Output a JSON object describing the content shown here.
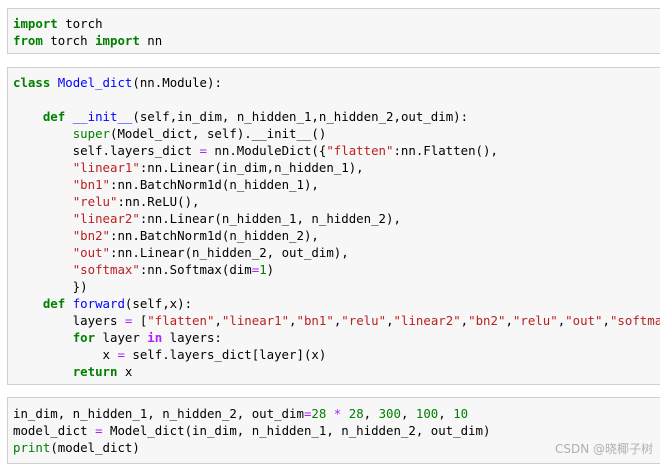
{
  "cells": [
    {
      "name": "import-cell",
      "lines": [
        [
          [
            "kw",
            "import"
          ],
          [
            "t",
            " torch"
          ]
        ],
        [
          [
            "kw",
            "from"
          ],
          [
            "t",
            " torch "
          ],
          [
            "kw",
            "import"
          ],
          [
            "t",
            " nn"
          ]
        ]
      ]
    },
    {
      "name": "class-cell",
      "lines": [
        [
          [
            "kw",
            "class"
          ],
          [
            "t",
            " "
          ],
          [
            "fn",
            "Model_dict"
          ],
          [
            "t",
            "(nn.Module):"
          ]
        ],
        [],
        [
          [
            "t",
            "    "
          ],
          [
            "kw",
            "def"
          ],
          [
            "t",
            " "
          ],
          [
            "fn",
            "__init__"
          ],
          [
            "t",
            "(self,in_dim, n_hidden_1,n_hidden_2,out_dim):"
          ]
        ],
        [
          [
            "t",
            "        "
          ],
          [
            "bi",
            "super"
          ],
          [
            "t",
            "(Model_dict, self).__init__()"
          ]
        ],
        [
          [
            "t",
            "        self.layers_dict "
          ],
          [
            "opn",
            "="
          ],
          [
            "t",
            " nn.ModuleDict({"
          ],
          [
            "str",
            "\"flatten\""
          ],
          [
            "t",
            ":nn.Flatten(),"
          ]
        ],
        [
          [
            "t",
            "        "
          ],
          [
            "str",
            "\"linear1\""
          ],
          [
            "t",
            ":nn.Linear(in_dim,n_hidden_1),"
          ]
        ],
        [
          [
            "t",
            "        "
          ],
          [
            "str",
            "\"bn1\""
          ],
          [
            "t",
            ":nn.BatchNorm1d(n_hidden_1),"
          ]
        ],
        [
          [
            "t",
            "        "
          ],
          [
            "str",
            "\"relu\""
          ],
          [
            "t",
            ":nn.ReLU(),"
          ]
        ],
        [
          [
            "t",
            "        "
          ],
          [
            "str",
            "\"linear2\""
          ],
          [
            "t",
            ":nn.Linear(n_hidden_1, n_hidden_2),"
          ]
        ],
        [
          [
            "t",
            "        "
          ],
          [
            "str",
            "\"bn2\""
          ],
          [
            "t",
            ":nn.BatchNorm1d(n_hidden_2),"
          ]
        ],
        [
          [
            "t",
            "        "
          ],
          [
            "str",
            "\"out\""
          ],
          [
            "t",
            ":nn.Linear(n_hidden_2, out_dim),"
          ]
        ],
        [
          [
            "t",
            "        "
          ],
          [
            "str",
            "\"softmax\""
          ],
          [
            "t",
            ":nn.Softmax(dim"
          ],
          [
            "opn",
            "="
          ],
          [
            "num",
            "1"
          ],
          [
            "t",
            ")"
          ]
        ],
        [
          [
            "t",
            "        })"
          ]
        ],
        [
          [
            "t",
            "    "
          ],
          [
            "kw",
            "def"
          ],
          [
            "t",
            " "
          ],
          [
            "fn",
            "forward"
          ],
          [
            "t",
            "(self,x):"
          ]
        ],
        [
          [
            "t",
            "        layers "
          ],
          [
            "opn",
            "="
          ],
          [
            "t",
            " ["
          ],
          [
            "str",
            "\"flatten\""
          ],
          [
            "t",
            ","
          ],
          [
            "str",
            "\"linear1\""
          ],
          [
            "t",
            ","
          ],
          [
            "str",
            "\"bn1\""
          ],
          [
            "t",
            ","
          ],
          [
            "str",
            "\"relu\""
          ],
          [
            "t",
            ","
          ],
          [
            "str",
            "\"linear2\""
          ],
          [
            "t",
            ","
          ],
          [
            "str",
            "\"bn2\""
          ],
          [
            "t",
            ","
          ],
          [
            "str",
            "\"relu\""
          ],
          [
            "t",
            ","
          ],
          [
            "str",
            "\"out\""
          ],
          [
            "t",
            ","
          ],
          [
            "str",
            "\"softmax\""
          ],
          [
            "t",
            "]"
          ]
        ],
        [
          [
            "t",
            "        "
          ],
          [
            "kw",
            "for"
          ],
          [
            "t",
            " layer "
          ],
          [
            "op",
            "in"
          ],
          [
            "t",
            " layers:"
          ]
        ],
        [
          [
            "t",
            "            x "
          ],
          [
            "opn",
            "="
          ],
          [
            "t",
            " self.layers_dict[layer](x)"
          ]
        ],
        [
          [
            "t",
            "        "
          ],
          [
            "kw",
            "return"
          ],
          [
            "t",
            " x"
          ]
        ]
      ]
    },
    {
      "name": "usage-cell",
      "lines": [
        [
          [
            "t",
            "in_dim, n_hidden_1, n_hidden_2, out_dim"
          ],
          [
            "opn",
            "="
          ],
          [
            "num",
            "28"
          ],
          [
            "t",
            " "
          ],
          [
            "opn",
            "*"
          ],
          [
            "t",
            " "
          ],
          [
            "num",
            "28"
          ],
          [
            "t",
            ", "
          ],
          [
            "num",
            "300"
          ],
          [
            "t",
            ", "
          ],
          [
            "num",
            "100"
          ],
          [
            "t",
            ", "
          ],
          [
            "num",
            "10"
          ]
        ],
        [
          [
            "t",
            "model_dict "
          ],
          [
            "opn",
            "="
          ],
          [
            "t",
            " Model_dict(in_dim, n_hidden_1, n_hidden_2, out_dim)"
          ]
        ],
        [
          [
            "bi",
            "print"
          ],
          [
            "t",
            "(model_dict)"
          ]
        ]
      ]
    }
  ],
  "watermark": "CSDN @晓椰子树"
}
